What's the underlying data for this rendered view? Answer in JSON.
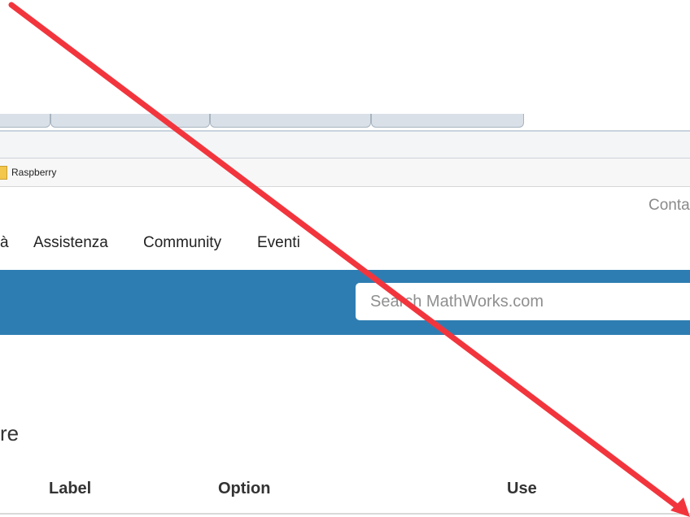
{
  "bookmarks_bar": {
    "folder_label": "Raspberry"
  },
  "header": {
    "contact_link": "Conta",
    "nav": [
      "à",
      "Assistenza",
      "Community",
      "Eventi"
    ]
  },
  "search": {
    "placeholder": "Search MathWorks.com"
  },
  "content": {
    "heading_fragment": "re",
    "table": {
      "columns": [
        "Label",
        "Option",
        "Use"
      ]
    }
  },
  "annotation": {
    "arrow_color": "#f2353d"
  },
  "colors": {
    "brand_bar": "#2e7db2"
  }
}
